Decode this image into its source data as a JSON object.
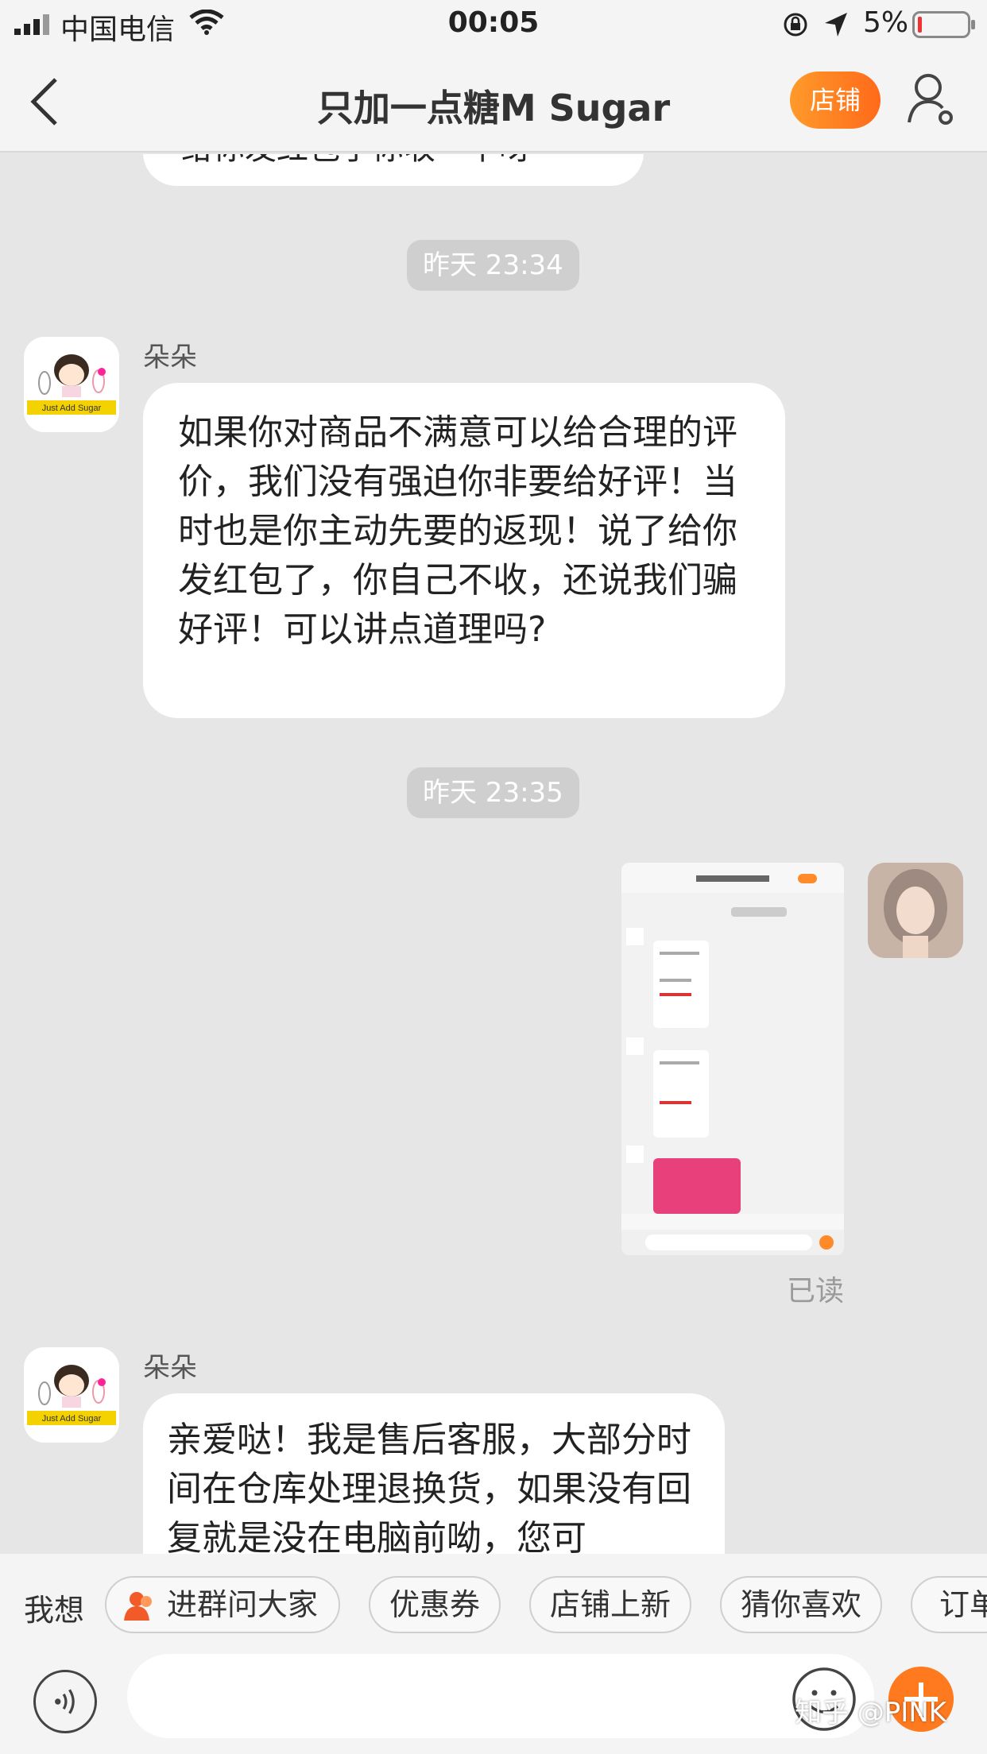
{
  "status_bar": {
    "carrier": "中国电信",
    "time": "00:05",
    "battery_pct": "5%"
  },
  "nav": {
    "title": "只加一点糖M Sugar",
    "shop_button": "店铺"
  },
  "messages": {
    "partial_text": "给你发红包了你收一下呀",
    "time1": "昨天 23:34",
    "sender1": "朵朵",
    "msg1": "如果你对商品不满意可以给合理的评价，我们没有强迫你非要给好评！当时也是你主动先要的返现！说了给你发红包了，你自己不收，还说我们骗好评！可以讲点道理吗?",
    "time2": "昨天 23:35",
    "read_status": "已读",
    "sender2": "朵朵",
    "msg2": "亲爱哒！我是售后客服，大部分时间在仓库处理退换货，如果没有回复就是没在电脑前呦，您可"
  },
  "avatar_logo_text": "Just Add Sugar",
  "quick_bar": {
    "label": "我想",
    "chips": [
      "进群问大家",
      "优惠券",
      "店铺上新",
      "猜你喜欢",
      "订单"
    ]
  },
  "watermark": "知乎 @PINK",
  "colors": {
    "accent": "#ff7a1f",
    "bg": "#e6e6e6",
    "pill": "#cfcfcf"
  },
  "icons": [
    "signal-icon",
    "wifi-icon",
    "rotation-lock-icon",
    "location-icon",
    "battery-icon",
    "back-icon",
    "user-settings-icon",
    "voice-icon",
    "emoji-icon",
    "plus-icon",
    "group-icon"
  ]
}
